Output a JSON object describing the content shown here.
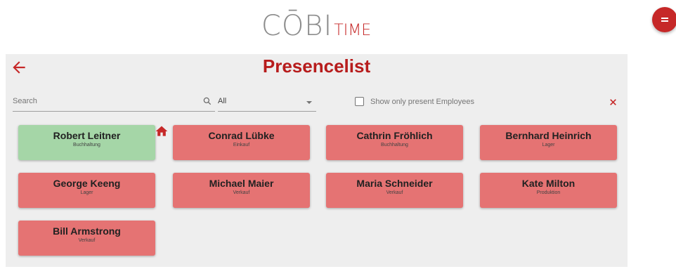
{
  "logo": {
    "main": "CŌBI",
    "sub": "TIME"
  },
  "page": {
    "title": "Presencelist"
  },
  "filters": {
    "search_placeholder": "Search",
    "department_value": "All",
    "present_only_label": "Show only present Employees",
    "present_only_checked": false
  },
  "employees": [
    {
      "name": "Robert Leitner",
      "department": "Buchhaltung",
      "present": true,
      "home": true
    },
    {
      "name": "Conrad Lübke",
      "department": "Einkauf",
      "present": false
    },
    {
      "name": "Cathrin Fröhlich",
      "department": "Buchhaltung",
      "present": false
    },
    {
      "name": "Bernhard Heinrich",
      "department": "Lager",
      "present": false
    },
    {
      "name": "George Keeng",
      "department": "Lager",
      "present": false
    },
    {
      "name": "Michael Maier",
      "department": "Verkauf",
      "present": false
    },
    {
      "name": "Maria Schneider",
      "department": "Verkauf",
      "present": false
    },
    {
      "name": "Kate Milton",
      "department": "Produktion",
      "present": false
    },
    {
      "name": "Bill Armstrong",
      "department": "Verkauf",
      "present": false
    }
  ],
  "colors": {
    "accent": "#c62828",
    "present": "#a5d6a7",
    "absent": "#e57373"
  },
  "icons": {
    "back": "arrow-left-icon",
    "search": "search-icon",
    "clear": "close-icon",
    "menu": "menu-icon",
    "home": "home-icon"
  }
}
